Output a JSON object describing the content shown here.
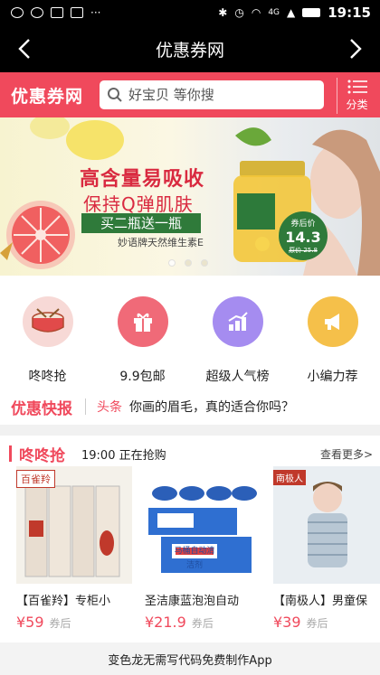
{
  "status_bar": {
    "time": "19:15",
    "network": "4G"
  },
  "titlebar": {
    "title": "优惠券网"
  },
  "header": {
    "logo": "优惠券网",
    "search_placeholder": "好宝贝 等你搜",
    "category_label": "分类"
  },
  "banner": {
    "headline": "高含量易吸收",
    "subhead": "保持Q弹肌肤",
    "promo": "买二瓶送一瓶",
    "product_name": "妙语牌天然维生素E",
    "price_label": "券后价",
    "price": "14.3",
    "original_price": "原价 25.8",
    "active_dot": 0
  },
  "quick_nav": [
    {
      "label": "咚咚抢",
      "icon": "drum-icon"
    },
    {
      "label": "9.9包邮",
      "icon": "gift-icon"
    },
    {
      "label": "超级人气榜",
      "icon": "chart-icon"
    },
    {
      "label": "小编力荐",
      "icon": "megaphone-icon"
    }
  ],
  "news": {
    "title": "优惠快报",
    "tag": "头条",
    "text": "你画的眉毛，真的适合你吗？"
  },
  "flash_sale": {
    "title": "咚咚抢",
    "time": "19:00 正在抢购",
    "more": "查看更多>",
    "products": [
      {
        "name": "【百雀羚】专柜小",
        "price": "¥59",
        "coupon": "券后",
        "brand": "百雀羚"
      },
      {
        "name": "圣洁康蓝泡泡自动",
        "price": "¥21.9",
        "coupon": "券后",
        "brand": "马桶自动清洁剂"
      },
      {
        "name": "【南极人】男童保",
        "price": "¥39",
        "coupon": "券后",
        "brand": "南极人"
      }
    ]
  },
  "footer": {
    "text": "变色龙无需写代码免费制作App"
  },
  "colors": {
    "brand": "#f0495c",
    "titlebar": "#000000"
  }
}
